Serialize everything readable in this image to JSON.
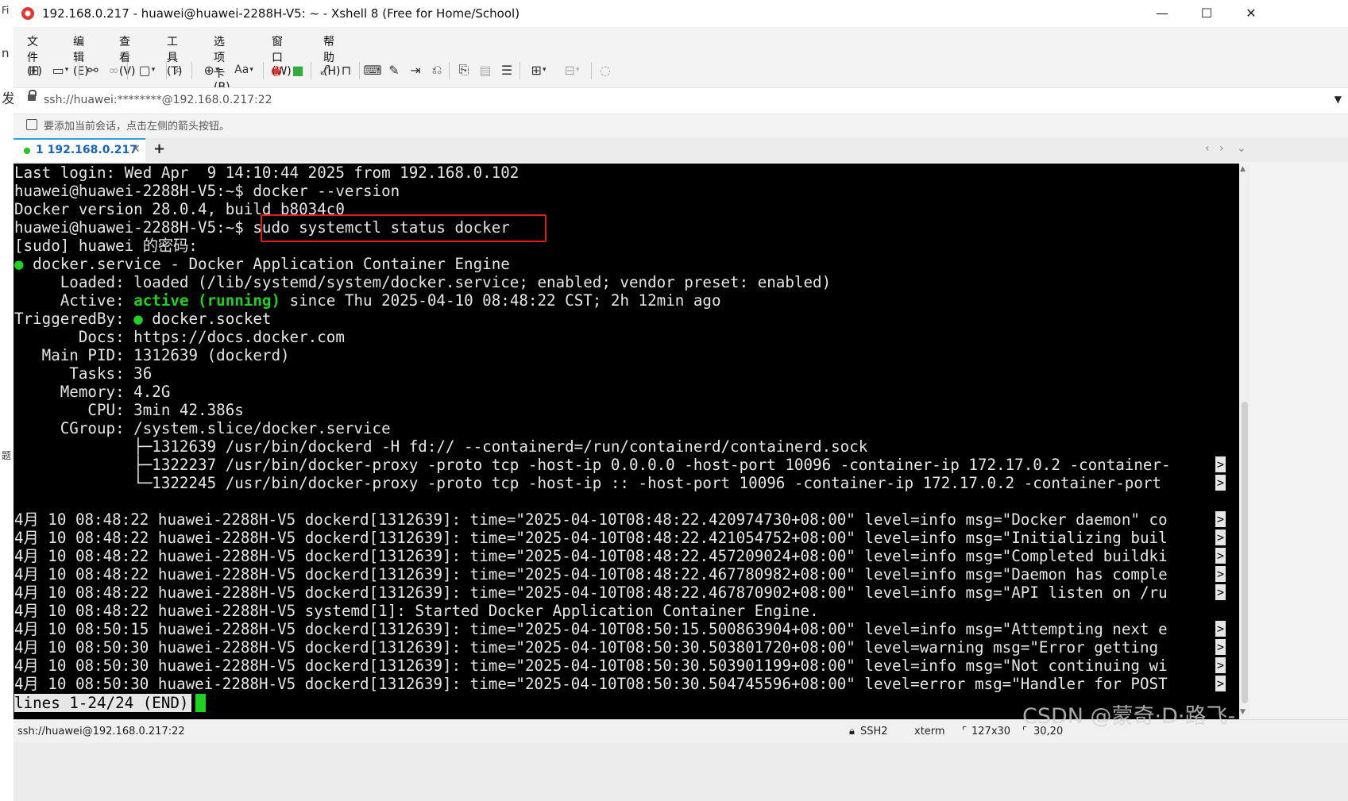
{
  "left_strip": [
    "Fi",
    "n",
    "发",
    "题"
  ],
  "window": {
    "title": "192.168.0.217 - huawei@huawei-2288H-V5: ~ - Xshell 8 (Free for Home/School)",
    "minimize": "—",
    "maximize": "☐",
    "close": "✕"
  },
  "menu": [
    "文件(F)",
    "编辑(E)",
    "查看(V)",
    "工具(T)",
    "选项卡(B)",
    "窗口(W)",
    "帮助(H)"
  ],
  "toolbar": {
    "icons": [
      "new-session-icon",
      "open-folder-icon",
      "disconnect-icon",
      "reconnect-icon",
      "new-window-icon",
      "find-icon",
      "globe-icon",
      "font-icon",
      "xftp-icon",
      "xagent-icon",
      "fullscreen-icon",
      "lock-icon",
      "keyboard-icon",
      "highlight-icon",
      "send-icon",
      "script-icon",
      "compose-icon",
      "compose-bar-icon",
      "quick-commands-icon",
      "new-tab-icon",
      "layout-icon",
      "chat-icon"
    ],
    "font_label": "Aa"
  },
  "address": {
    "value": "ssh://huawei:********@192.168.0.217:22"
  },
  "hint": {
    "text": "要添加当前会话，点击左侧的箭头按钮。"
  },
  "tabs": [
    {
      "label": "1 192.168.0.217",
      "close": "✕"
    }
  ],
  "tab_add": "+",
  "tab_nav": {
    "prev": "‹",
    "next": "›",
    "menu": "⌄"
  },
  "terminal": {
    "lines": [
      "Last login: Wed Apr  9 14:10:44 2025 from 192.168.0.102",
      "huawei@huawei-2288H-V5:~$ docker --version",
      "Docker version 28.0.4, build b8034c0",
      "huawei@huawei-2288H-V5:~$ sudo systemctl status docker",
      "[sudo] huawei 的密码:"
    ],
    "service_dot": "●",
    "service_line": " docker.service - Docker Application Container Engine",
    "loaded_line": "     Loaded: loaded (/lib/systemd/system/docker.service; enabled; vendor preset: enabled)",
    "active_label": "     Active: ",
    "active_state": "active (running)",
    "active_rest": " since Thu 2025-04-10 08:48:22 CST; 2h 12min ago",
    "triggered_label": "TriggeredBy: ",
    "triggered_dot": "●",
    "triggered_rest": " docker.socket",
    "detail_lines": [
      "       Docs: https://docs.docker.com",
      "   Main PID: 1312639 (dockerd)",
      "      Tasks: 36",
      "     Memory: 4.2G",
      "        CPU: 3min 42.386s",
      "     CGroup: /system.slice/docker.service",
      "             ├─1312639 /usr/bin/dockerd -H fd:// --containerd=/run/containerd/containerd.sock",
      "             ├─1322237 /usr/bin/docker-proxy -proto tcp -host-ip 0.0.0.0 -host-port 10096 -container-ip 172.17.0.2 -container-",
      "             └─1322245 /usr/bin/docker-proxy -proto tcp -host-ip :: -host-port 10096 -container-ip 172.17.0.2 -container-port "
    ],
    "log_lines": [
      "4月 10 08:48:22 huawei-2288H-V5 dockerd[1312639]: time=\"2025-04-10T08:48:22.420974730+08:00\" level=info msg=\"Docker daemon\" co",
      "4月 10 08:48:22 huawei-2288H-V5 dockerd[1312639]: time=\"2025-04-10T08:48:22.421054752+08:00\" level=info msg=\"Initializing buil",
      "4月 10 08:48:22 huawei-2288H-V5 dockerd[1312639]: time=\"2025-04-10T08:48:22.457209024+08:00\" level=info msg=\"Completed buildki",
      "4月 10 08:48:22 huawei-2288H-V5 dockerd[1312639]: time=\"2025-04-10T08:48:22.467780982+08:00\" level=info msg=\"Daemon has comple",
      "4月 10 08:48:22 huawei-2288H-V5 dockerd[1312639]: time=\"2025-04-10T08:48:22.467870902+08:00\" level=info msg=\"API listen on /ru",
      "4月 10 08:48:22 huawei-2288H-V5 systemd[1]: Started Docker Application Container Engine.",
      "4月 10 08:50:15 huawei-2288H-V5 dockerd[1312639]: time=\"2025-04-10T08:50:15.500863904+08:00\" level=info msg=\"Attempting next e",
      "4月 10 08:50:30 huawei-2288H-V5 dockerd[1312639]: time=\"2025-04-10T08:50:30.503801720+08:00\" level=warning msg=\"Error getting ",
      "4月 10 08:50:30 huawei-2288H-V5 dockerd[1312639]: time=\"2025-04-10T08:50:30.503901199+08:00\" level=info msg=\"Not continuing wi",
      "4月 10 08:50:30 huawei-2288H-V5 dockerd[1312639]: time=\"2025-04-10T08:50:30.504745596+08:00\" level=error msg=\"Handler for POST"
    ],
    "truncation_marker": ">",
    "pager_status": "lines 1-24/24 (END)"
  },
  "statusbar": {
    "connection": "ssh://huawei@192.168.0.217:22",
    "protocol": "SSH2",
    "terminal_type": "xterm",
    "size": "127x30",
    "cursor_pos": "30,20"
  },
  "watermark": "CSDN @蒙奇·D·路飞-",
  "colors": {
    "accent": "#2f9fe0",
    "terminal_bg": "#000000",
    "terminal_fg": "#e6e6e6",
    "terminal_green": "#1fd21f",
    "highlight_red": "#e01b1b"
  }
}
